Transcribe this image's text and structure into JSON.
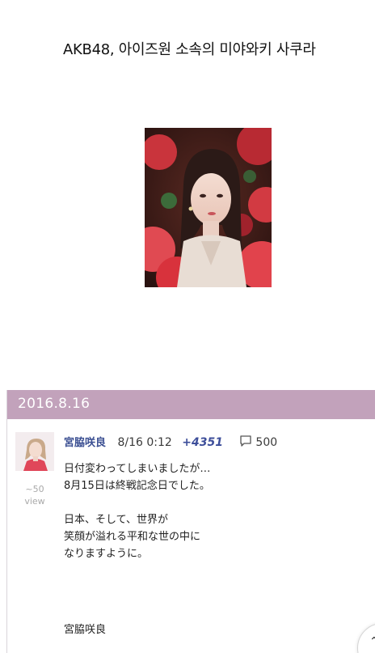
{
  "article": {
    "headline": "AKB48, 아이즈원 소속의 미야와키 사쿠라"
  },
  "post": {
    "date": "2016.8.16",
    "author": "宮脇咲良",
    "time": "8/16 0:12",
    "plus_count": "+4351",
    "comment_count": "500",
    "views_count": "~50",
    "views_label": "view",
    "body_lines": [
      "日付変わってしまいましたが…",
      "8月15日は終戦記念日でした。",
      "",
      "日本、そして、世界が",
      "笑顔が溢れる平和な世の中に",
      "なりますように。"
    ],
    "signature": "宮脇咲良"
  },
  "icons": {
    "comment": "speech-bubble-icon",
    "scroll_top": "chevron-up-icon"
  },
  "colors": {
    "date_bar": "#c2a2bb",
    "author": "#3b4f92",
    "plus": "#3d4e9a"
  }
}
